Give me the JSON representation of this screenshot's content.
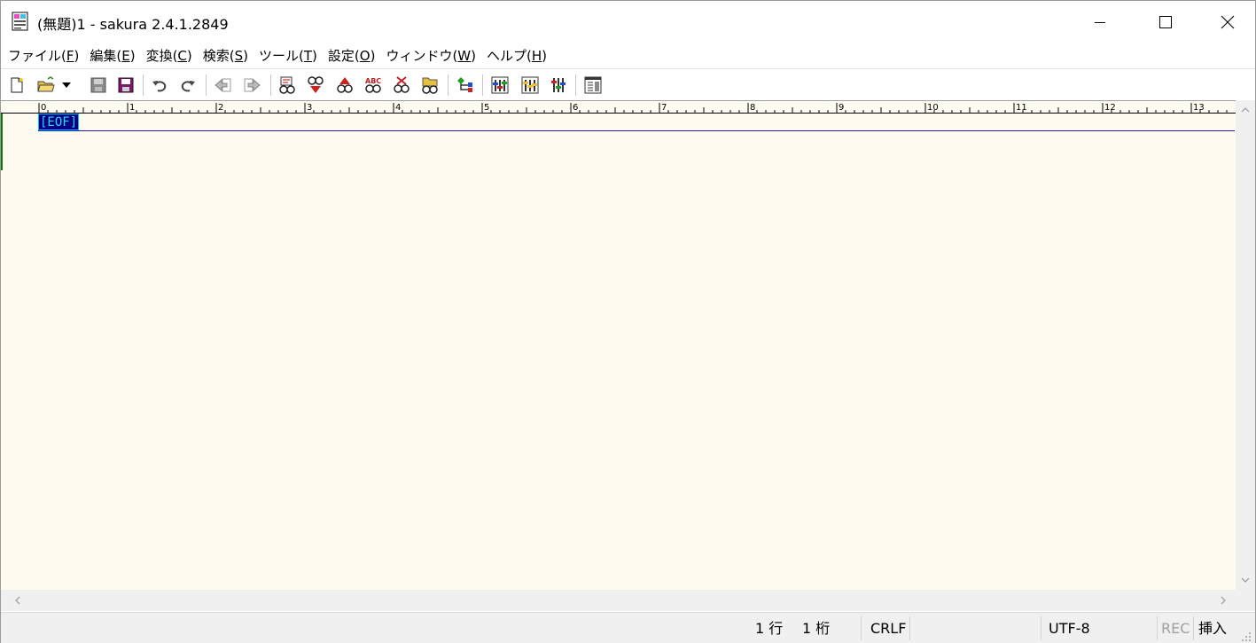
{
  "window": {
    "title": "(無題)1 - sakura 2.4.1.2849"
  },
  "menu": [
    {
      "label": "ファイル(",
      "acc": "F",
      "end": ")"
    },
    {
      "label": "編集(",
      "acc": "E",
      "end": ")"
    },
    {
      "label": "変換(",
      "acc": "C",
      "end": ")"
    },
    {
      "label": "検索(",
      "acc": "S",
      "end": ")"
    },
    {
      "label": "ツール(",
      "acc": "T",
      "end": ")"
    },
    {
      "label": "設定(",
      "acc": "O",
      "end": ")"
    },
    {
      "label": "ウィンドウ(",
      "acc": "W",
      "end": ")"
    },
    {
      "label": "ヘルプ(",
      "acc": "H",
      "end": ")"
    }
  ],
  "ruler": {
    "labels": [
      "0",
      "1",
      "2",
      "3",
      "4",
      "5",
      "6",
      "7",
      "8",
      "9",
      "10",
      "11",
      "12",
      "13"
    ]
  },
  "editor": {
    "eof_marker": "[EOF]"
  },
  "status": {
    "line": "1 行",
    "column": "1 桁",
    "line_ending": "CRLF",
    "encoding": "UTF-8",
    "rec": "REC",
    "mode": "挿入"
  },
  "colors": {
    "editor_background": "#fffbf0",
    "eof_background": "#000080",
    "eof_text": "#2ad7ff",
    "rec_disabled": "#a0a0a0"
  }
}
